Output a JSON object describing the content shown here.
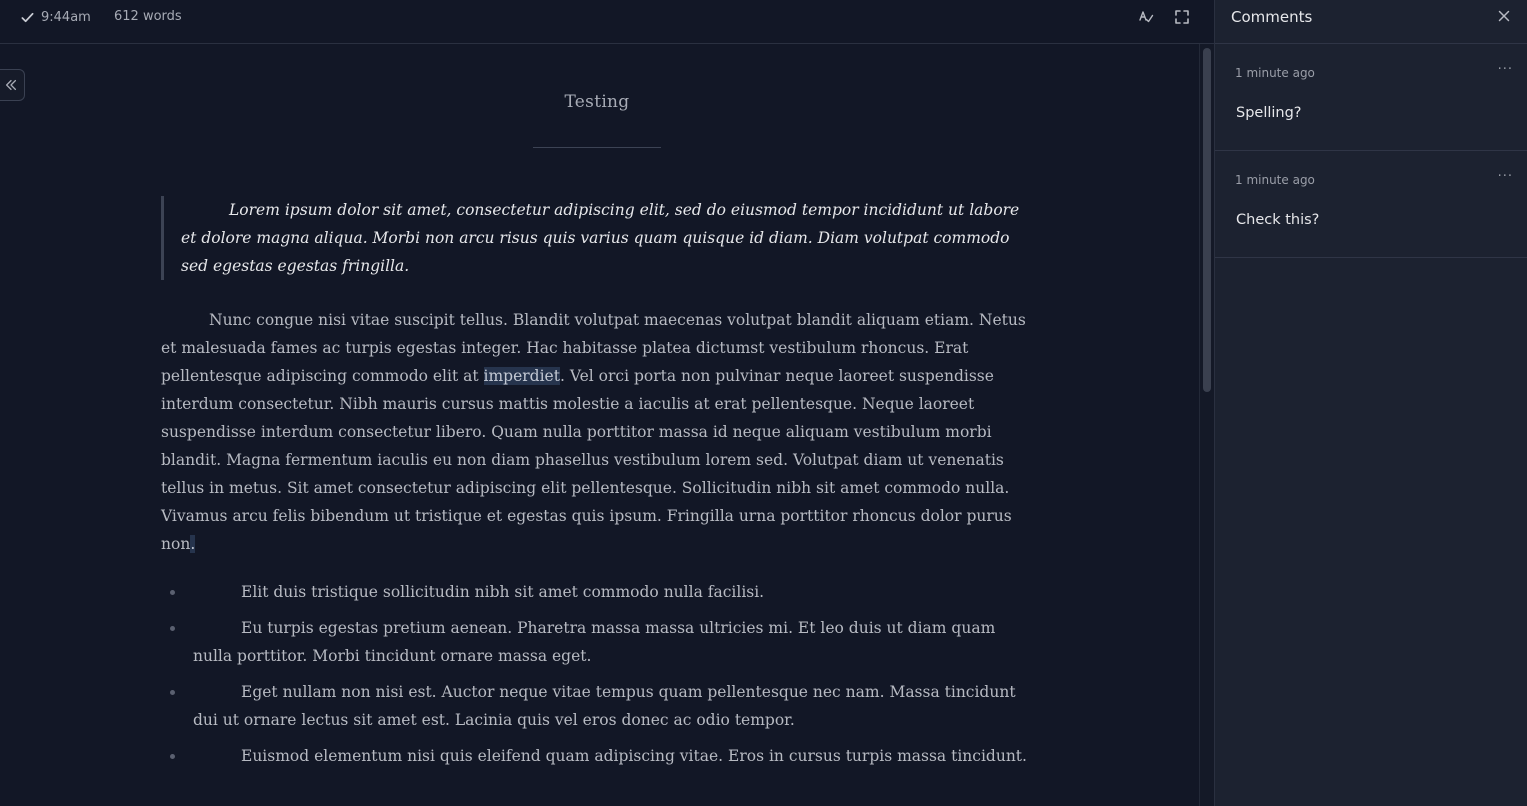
{
  "toolbar": {
    "saved_time": "9:44am",
    "word_count": "612 words"
  },
  "document": {
    "title": "Testing",
    "quote": "Lorem ipsum dolor sit amet, consectetur adipiscing elit, sed do eiusmod tempor incididunt ut labore et dolore magna aliqua. Morbi non arcu risus quis varius quam quisque id diam. Diam volutpat commodo sed egestas egestas fringilla.",
    "paragraph_part1": "Nunc congue nisi vitae suscipit tellus. Blandit volutpat maecenas volutpat blandit aliquam etiam. Netus et malesuada fames ac turpis egestas integer. Hac habitasse platea dictumst vestibulum rhoncus. Erat pellentesque adipiscing commodo elit at ",
    "paragraph_highlight": "imperdiet",
    "paragraph_part2": ". Vel orci porta non pulvinar neque laoreet suspendisse interdum consectetur. Nibh mauris cursus mattis molestie a iaculis at erat pellentesque. Neque laoreet suspendisse interdum consectetur libero. Quam nulla porttitor massa id neque aliquam vestibulum morbi blandit. Magna fermentum iaculis eu non diam phasellus vestibulum lorem sed. Volutpat diam ut venenatis tellus in metus. Sit amet consectetur adipiscing elit pellentesque. Sollicitudin nibh sit amet commodo nulla. Vivamus arcu felis bibendum ut tristique et egestas quis ipsum. Fringilla urna porttitor rhoncus dolor purus non",
    "paragraph_end": ".",
    "list": [
      "Elit duis tristique sollicitudin nibh sit amet commodo nulla facilisi.",
      "Eu turpis egestas pretium aenean. Pharetra massa massa ultricies mi. Et leo duis ut diam quam nulla porttitor. Morbi tincidunt ornare massa eget.",
      "Eget nullam non nisi est. Auctor neque vitae tempus quam pellentesque nec nam. Massa tincidunt dui ut ornare lectus sit amet est. Lacinia quis vel eros donec ac odio tempor.",
      "Euismod elementum nisi quis eleifend quam adipiscing vitae. Eros in cursus turpis massa tincidunt."
    ]
  },
  "comments_panel": {
    "title": "Comments",
    "more_glyph": "···",
    "comments": [
      {
        "time": "1 minute ago",
        "text": "Spelling?"
      },
      {
        "time": "1 minute ago",
        "text": "Check this?"
      }
    ]
  },
  "colors": {
    "background": "#121726",
    "panel": "#1c2230",
    "highlight": "#26344d"
  }
}
